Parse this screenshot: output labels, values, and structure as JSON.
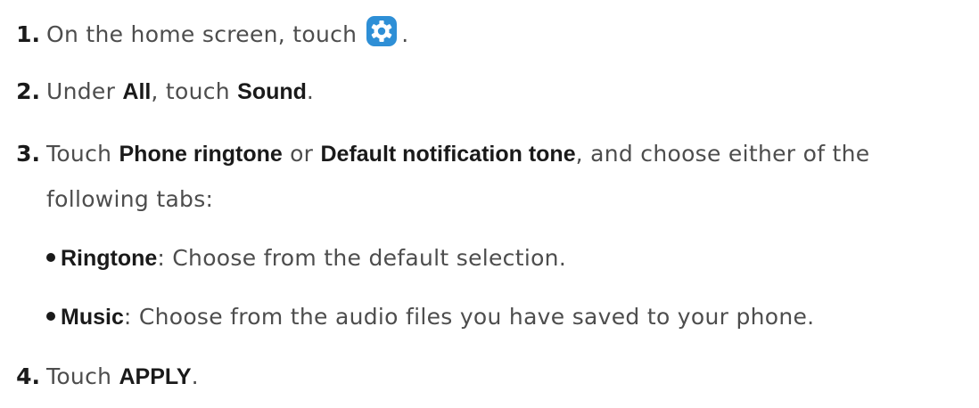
{
  "steps": [
    {
      "number": "1.",
      "prefix": "On the home screen, touch",
      "icon": "settings-gear-icon",
      "suffix": "."
    },
    {
      "number": "2.",
      "prefix": "Under ",
      "bold1": "All",
      "mid": ", touch ",
      "bold2": "Sound",
      "suffix": "."
    },
    {
      "number": "3.",
      "prefix": "Touch ",
      "bold1": "Phone ringtone",
      "mid": " or ",
      "bold2": "Default notification tone",
      "suffix": ", and choose either of the",
      "continuation": "following tabs:",
      "options": [
        {
          "bold": "Ringtone",
          "text": ": Choose from the default selection."
        },
        {
          "bold": "Music",
          "text": ": Choose from the audio files you have saved to your phone."
        }
      ]
    },
    {
      "number": "4.",
      "prefix": "Touch ",
      "bold1": "APPLY",
      "suffix": "."
    }
  ],
  "colors": {
    "icon_blue": "#2e8fd6",
    "text": "#4d4d4d",
    "bold": "#1a1a1a"
  }
}
